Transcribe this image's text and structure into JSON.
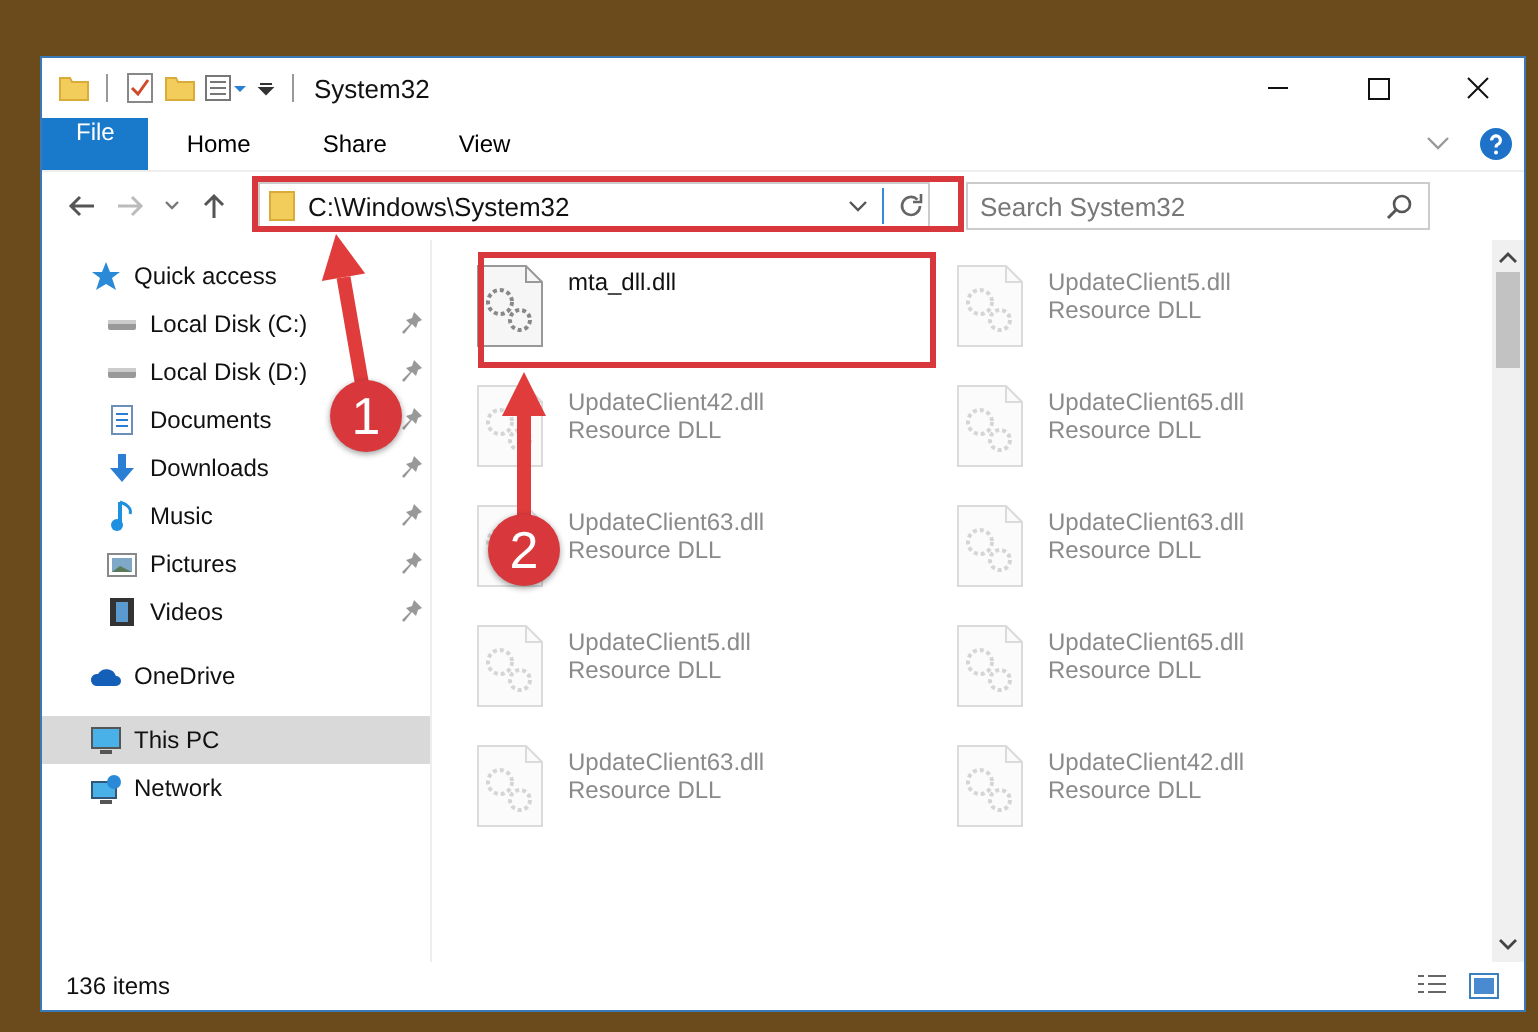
{
  "window": {
    "title": "System32"
  },
  "ribbon_tabs": [
    {
      "label": "File",
      "kind": "file"
    },
    {
      "label": "Home",
      "kind": "tab"
    },
    {
      "label": "Share",
      "kind": "tab"
    },
    {
      "label": "View",
      "kind": "tab"
    }
  ],
  "address_bar": {
    "path": "C:\\Windows\\System32"
  },
  "search": {
    "placeholder": "Search System32"
  },
  "sidebar": {
    "items": [
      {
        "label": "Quick access",
        "kind": "star",
        "selected": false,
        "children": [
          {
            "label": "Local Disk (C:)",
            "kind": "disk",
            "pinned": true,
            "selected": false
          },
          {
            "label": "Local Disk (D:)",
            "kind": "disk",
            "pinned": true,
            "selected": false
          },
          {
            "label": "Documents",
            "kind": "document",
            "pinned": true,
            "selected": false
          },
          {
            "label": "Downloads",
            "kind": "download",
            "pinned": true,
            "selected": false
          },
          {
            "label": "Music",
            "kind": "music",
            "pinned": true,
            "selected": false
          },
          {
            "label": "Pictures",
            "kind": "picture",
            "pinned": true,
            "selected": false
          },
          {
            "label": "Videos",
            "kind": "video",
            "pinned": true,
            "selected": false
          }
        ]
      },
      {
        "label": "OneDrive",
        "kind": "cloud",
        "selected": false
      },
      {
        "label": "This PC",
        "kind": "monitor",
        "selected": true
      },
      {
        "label": "Network",
        "kind": "network",
        "selected": false
      }
    ]
  },
  "files": [
    {
      "name": "mta_dll.dll",
      "faded": false
    },
    {
      "name": "UpdateClient5.dll",
      "type": "Resource DLL",
      "faded": true
    },
    {
      "name": "UpdateClient42.dll",
      "type": "Resource DLL",
      "faded": true
    },
    {
      "name": "UpdateClient65.dll",
      "type": "Resource DLL",
      "faded": true
    },
    {
      "name": "UpdateClient63.dll",
      "type": "Resource DLL",
      "faded": true
    },
    {
      "name": "UpdateClient63.dll",
      "type": "Resource DLL",
      "faded": true
    },
    {
      "name": "UpdateClient5.dll",
      "type": "Resource DLL",
      "faded": true
    },
    {
      "name": "UpdateClient65.dll",
      "type": "Resource DLL",
      "faded": true
    },
    {
      "name": "UpdateClient63.dll",
      "type": "Resource DLL",
      "faded": true
    },
    {
      "name": "UpdateClient42.dll",
      "type": "Resource DLL",
      "faded": true
    }
  ],
  "status_bar": {
    "count": "136 items"
  },
  "annotations": [
    {
      "number": "1"
    },
    {
      "number": "2"
    }
  ]
}
